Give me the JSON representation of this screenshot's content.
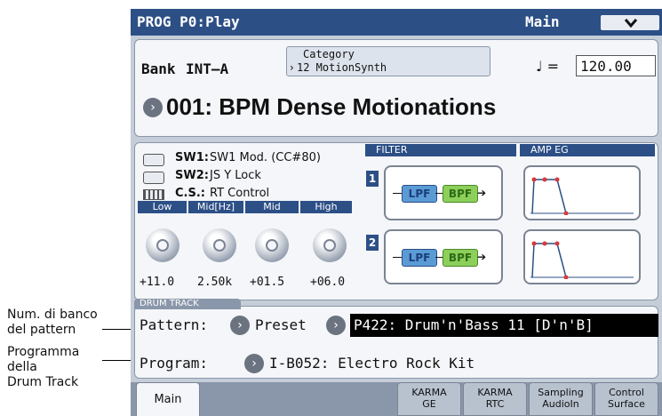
{
  "annotations": {
    "bank_label": "Num. di banco\ndel pattern",
    "program_label": "Programma\ndella\nDrum Track"
  },
  "header": {
    "title": "PROG P0:Play",
    "page": "Main",
    "dropdown_icon": "chevron-down-icon"
  },
  "program": {
    "bank_label": "Bank",
    "bank_value": "INT–A",
    "category_label": "Category",
    "category_value": "12 MotionSynth",
    "tempo_symbol": "♩ =",
    "tempo_value": "120.00",
    "name": "001: BPM Dense Motionations"
  },
  "controls": {
    "sw1_label": "SW1:",
    "sw1_value": "SW1 Mod. (CC#80)",
    "sw2_label": "SW2:",
    "sw2_value": "JS Y Lock",
    "cs_label": "C.S.:",
    "cs_value": "RT Control",
    "eq": [
      {
        "label": "Low",
        "value": "+11.0"
      },
      {
        "label": "Mid[Hz]",
        "value": "2.50k"
      },
      {
        "label": "Mid",
        "value": "+01.5"
      },
      {
        "label": "High",
        "value": "+06.0"
      }
    ]
  },
  "filter_section": {
    "filter_title": "FILTER",
    "amp_title": "AMP EG",
    "rows": [
      {
        "num": "1",
        "f1": "LPF",
        "f2": "BPF"
      },
      {
        "num": "2",
        "f1": "LPF",
        "f2": "BPF"
      }
    ]
  },
  "drum": {
    "section_title": "DRUM TRACK",
    "pattern_label": "Pattern:",
    "pattern_bank": "Preset",
    "pattern_value": "P422: Drum'n'Bass 11 [D'n'B]",
    "program_label": "Program:",
    "program_value": "I-B052: Electro Rock Kit"
  },
  "tabs": [
    {
      "line1": "Main",
      "line2": ""
    },
    {
      "line1": "KARMA",
      "line2": "GE"
    },
    {
      "line1": "KARMA",
      "line2": "RTC"
    },
    {
      "line1": "Sampling",
      "line2": "AudioIn"
    },
    {
      "line1": "Control",
      "line2": "Surface"
    }
  ],
  "colors": {
    "title_bar": "#2c4f86",
    "lpf": "#5b9bd5",
    "bpf": "#8ccf5a",
    "screen_bg": "#c4cdd8"
  }
}
